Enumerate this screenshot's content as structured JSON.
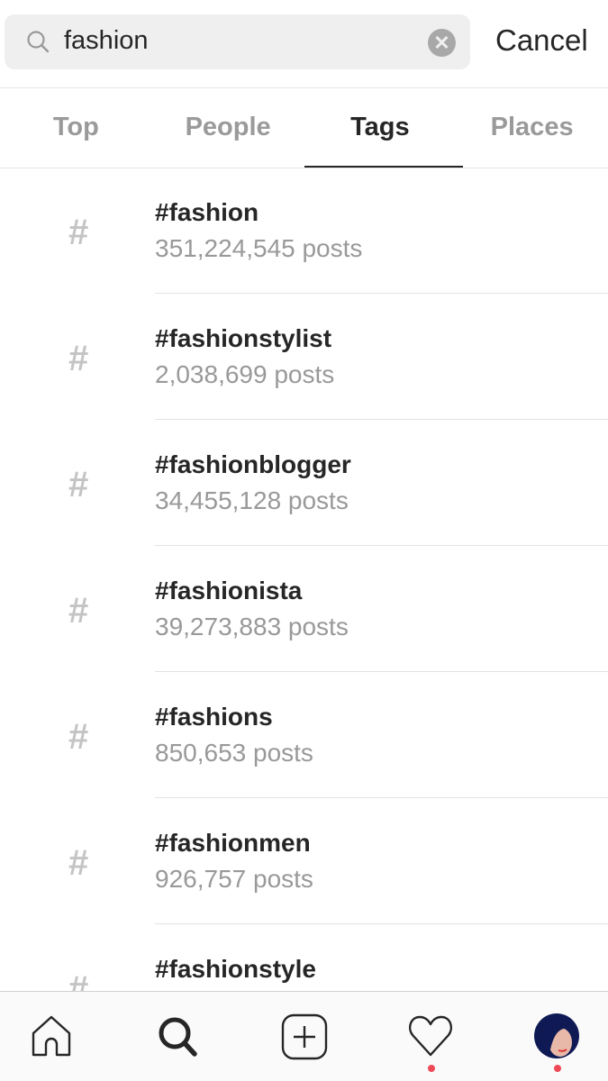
{
  "search": {
    "value": "fashion",
    "search_icon": "search-icon",
    "clear_icon": "clear-icon"
  },
  "cancel_label": "Cancel",
  "tabs": [
    {
      "label": "Top"
    },
    {
      "label": "People"
    },
    {
      "label": "Tags",
      "active": true
    },
    {
      "label": "Places"
    }
  ],
  "results": [
    {
      "icon": "#",
      "name": "#fashion",
      "count": "351,224,545 posts"
    },
    {
      "icon": "#",
      "name": "#fashionstylist",
      "count": "2,038,699 posts"
    },
    {
      "icon": "#",
      "name": "#fashionblogger",
      "count": "34,455,128 posts"
    },
    {
      "icon": "#",
      "name": "#fashionista",
      "count": "39,273,883 posts"
    },
    {
      "icon": "#",
      "name": "#fashions",
      "count": "850,653 posts"
    },
    {
      "icon": "#",
      "name": "#fashionmen",
      "count": "926,757 posts"
    },
    {
      "icon": "#",
      "name": "#fashionstyle",
      "count": ""
    }
  ],
  "bottom_nav": [
    "home-icon",
    "search-icon",
    "new-post-icon",
    "activity-heart-icon",
    "profile-avatar"
  ],
  "colors": {
    "notification_dot": "#ed4956",
    "active": "#262626",
    "inactive": "#9a9a9a"
  }
}
